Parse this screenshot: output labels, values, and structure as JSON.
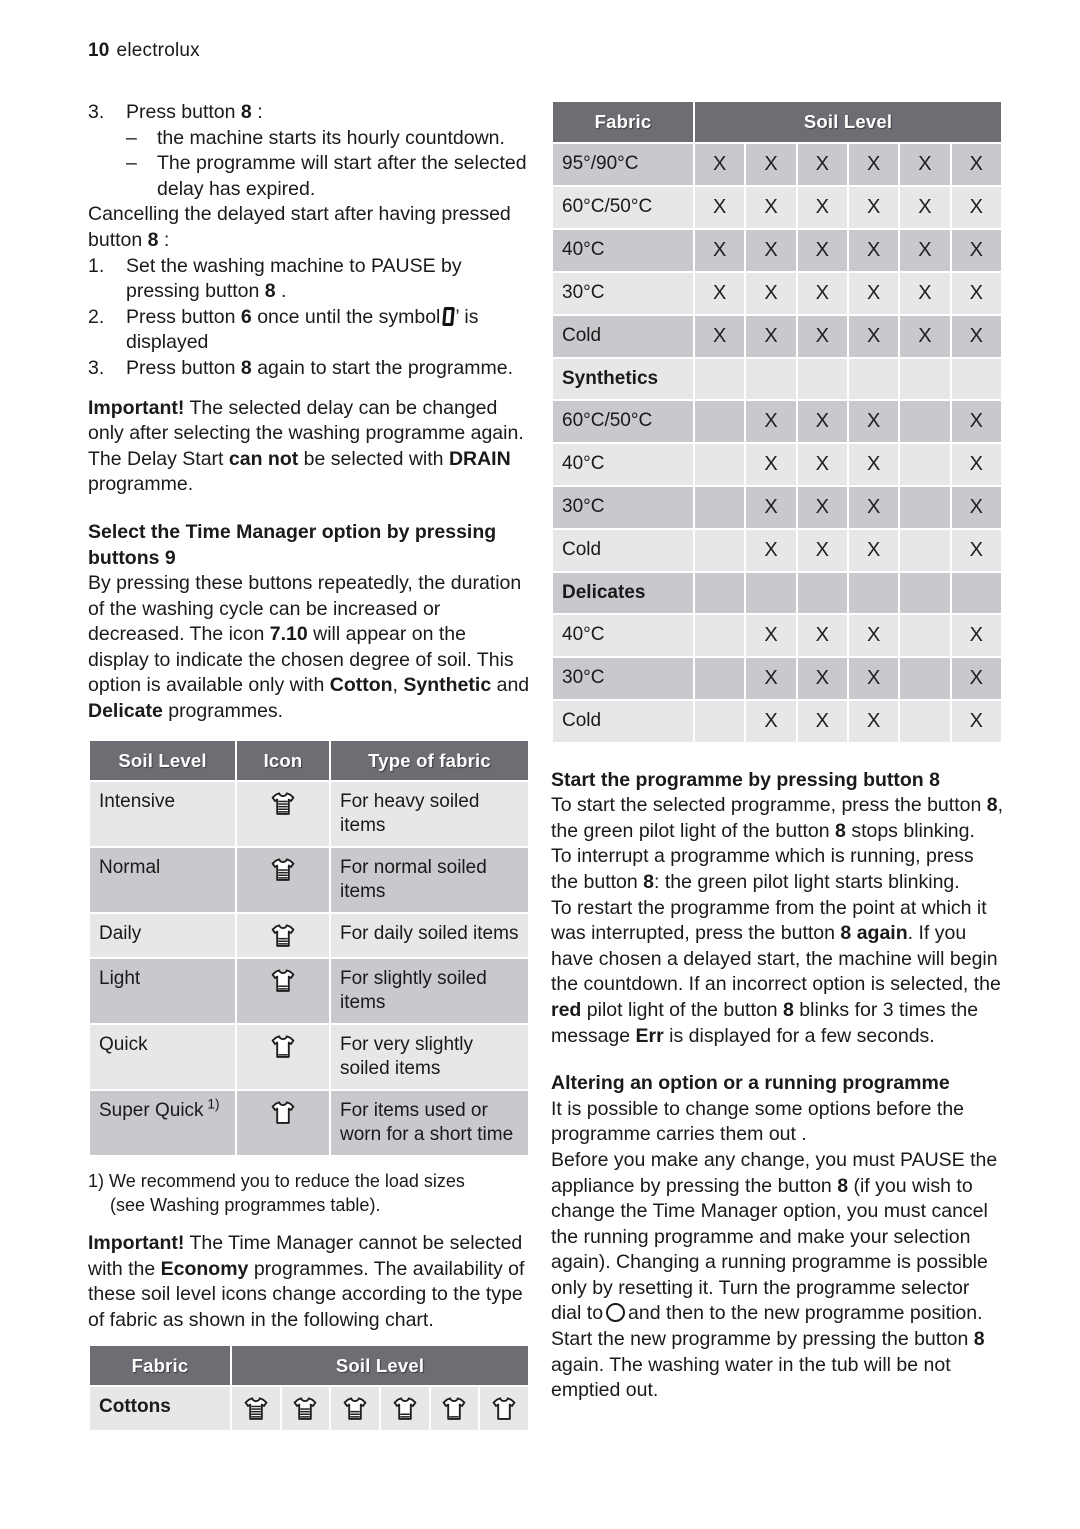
{
  "header": {
    "page_number": "10",
    "brand": "electrolux"
  },
  "left_column": {
    "step3": {
      "marker": "3.",
      "text": "Press button",
      "button": "8",
      "colon": ":",
      "sub1_marker": "–",
      "sub1": "the machine starts its hourly countdown.",
      "sub2_marker": "–",
      "sub2": "The programme will start after the selected delay has expired."
    },
    "cancel_intro_a": "Cancelling the delayed start after having pressed button",
    "cancel_intro_button": "8",
    "cancel_intro_b": ":",
    "cancel_steps": [
      {
        "marker": "1.",
        "pre": "Set the washing machine to PAUSE by pressing button",
        "button": "8",
        "post": "."
      },
      {
        "marker": "2.",
        "pre": "Press button",
        "button": "6",
        "mid": "once until the symbol",
        "post": "’ is displayed"
      },
      {
        "marker": "3.",
        "pre": "Press button",
        "button": "8",
        "post": "again to start the programme."
      }
    ],
    "important1_label": "Important!",
    "important1_text": "The selected delay can be changed only after selecting the washing programme again.",
    "drain_a": "The Delay Start",
    "drain_bold1": "can not",
    "drain_b": "be selected with",
    "drain_bold2": "DRAIN",
    "drain_c": "programme.",
    "time_manager_heading": "Select the Time Manager option by pressing buttons 9",
    "time_manager_p1": "By pressing these buttons repeatedly, the duration of the washing cycle can be increased or decreased. The icon",
    "time_manager_icon_ref": "7.10",
    "time_manager_p2": "will appear on the display to indicate the chosen degree of soil. This option is available only with",
    "fabric_cotton": "Cotton",
    "fabric_sep1": ",",
    "fabric_synthetic": "Synthetic",
    "fabric_and": "and",
    "fabric_delicate": "Delicate",
    "time_manager_p3": "programmes.",
    "soil_table": {
      "headers": [
        "Soil Level",
        "Icon",
        "Type of fabric"
      ],
      "rows": [
        {
          "level": "Intensive",
          "fill": 5,
          "fabric": "For heavy soiled items"
        },
        {
          "level": "Normal",
          "fill": 4,
          "fabric": "For normal soiled items"
        },
        {
          "level": "Daily",
          "fill": 3,
          "fabric": "For daily soiled items"
        },
        {
          "level": "Light",
          "fill": 2,
          "fabric": "For slightly soiled items"
        },
        {
          "level": "Quick",
          "fill": 1,
          "fabric": "For very slightly soiled items"
        },
        {
          "level": "Super Quick",
          "footnote": "1)",
          "fill": 0,
          "fabric": "For items used or worn for a short time"
        }
      ]
    },
    "footnote_marker": "1)",
    "footnote_line1": "We recommend you to reduce the load sizes",
    "footnote_line2": "(see Washing programmes table).",
    "important2_label": "Important!",
    "important2_a": "The Time Manager cannot be selected with the",
    "important2_bold": "Economy",
    "important2_b": "programmes. The availability of these soil level icons change according to the type of fabric as shown in the following chart.",
    "fabric_table": {
      "headers": [
        "Fabric",
        "Soil Level"
      ],
      "rows": [
        {
          "fabric": "Cottons",
          "fills": [
            5,
            4,
            3,
            2,
            1,
            0
          ]
        }
      ]
    }
  },
  "right_column": {
    "soil_matrix": {
      "headers": [
        "Fabric",
        "Soil Level"
      ],
      "columns": 6,
      "rows": [
        {
          "label": "95°/90°C",
          "type": "data",
          "shade": "dark",
          "marks": [
            "X",
            "X",
            "X",
            "X",
            "X",
            "X"
          ]
        },
        {
          "label": "60°C/50°C",
          "type": "data",
          "shade": "lite",
          "marks": [
            "X",
            "X",
            "X",
            "X",
            "X",
            "X"
          ]
        },
        {
          "label": "40°C",
          "type": "data",
          "shade": "dark",
          "marks": [
            "X",
            "X",
            "X",
            "X",
            "X",
            "X"
          ]
        },
        {
          "label": "30°C",
          "type": "data",
          "shade": "lite",
          "marks": [
            "X",
            "X",
            "X",
            "X",
            "X",
            "X"
          ]
        },
        {
          "label": "Cold",
          "type": "data",
          "shade": "dark",
          "marks": [
            "X",
            "X",
            "X",
            "X",
            "X",
            "X"
          ]
        },
        {
          "label": "Synthetics",
          "type": "group",
          "shade": "lite",
          "marks": [
            "",
            "",
            "",
            "",
            "",
            ""
          ]
        },
        {
          "label": "60°C/50°C",
          "type": "data",
          "shade": "dark",
          "marks": [
            "",
            "X",
            "X",
            "X",
            "",
            "X"
          ]
        },
        {
          "label": "40°C",
          "type": "data",
          "shade": "lite",
          "marks": [
            "",
            "X",
            "X",
            "X",
            "",
            "X"
          ]
        },
        {
          "label": "30°C",
          "type": "data",
          "shade": "dark",
          "marks": [
            "",
            "X",
            "X",
            "X",
            "",
            "X"
          ]
        },
        {
          "label": "Cold",
          "type": "data",
          "shade": "lite",
          "marks": [
            "",
            "X",
            "X",
            "X",
            "",
            "X"
          ]
        },
        {
          "label": "Delicates",
          "type": "group",
          "shade": "dark",
          "marks": [
            "",
            "",
            "",
            "",
            "",
            ""
          ]
        },
        {
          "label": "40°C",
          "type": "data",
          "shade": "lite",
          "marks": [
            "",
            "X",
            "X",
            "X",
            "",
            "X"
          ]
        },
        {
          "label": "30°C",
          "type": "data",
          "shade": "dark",
          "marks": [
            "",
            "X",
            "X",
            "X",
            "",
            "X"
          ]
        },
        {
          "label": "Cold",
          "type": "data",
          "shade": "lite",
          "marks": [
            "",
            "X",
            "X",
            "X",
            "",
            "X"
          ]
        }
      ]
    },
    "start_heading": "Start the programme by pressing button 8",
    "start_p1_a": "To start the selected programme, press the button",
    "start_p1_btn1": "8",
    "start_p1_b": ", the green pilot light of the button",
    "start_p1_btn2": "8",
    "start_p1_c": "stops blinking.",
    "start_p2_a": "To interrupt a programme which is running, press the button",
    "start_p2_btn": "8",
    "start_p2_b": ": the green pilot light starts blinking.",
    "start_p3_a": "To restart the programme from the point at which it was interrupted, press the button",
    "start_p3_btn": "8",
    "start_p3_bold": "again",
    "start_p3_b": ". If you have chosen a delayed start, the machine will begin the countdown. If an incorrect option is selected, the",
    "start_p3_red": "red",
    "start_p3_c": "pilot light of the button",
    "start_p3_btn2": "8",
    "start_p3_d": "blinks for 3 times the message",
    "start_p3_err": "Err",
    "start_p3_e": "is displayed for a few seconds.",
    "alter_heading": "Altering an option or a running programme",
    "alter_p1": "It is possible to change some options before the programme carries them out .",
    "alter_p2_a": "Before you make any change, you must PAUSE the appliance by pressing the button",
    "alter_p2_btn": "8",
    "alter_p2_b": "(if you wish to change the Time Manager option, you must cancel the running programme and make your selection again). Changing a running programme is possible only by resetting it. Turn the programme selector dial to",
    "alter_p2_c": "and then to the new programme position. Start the new programme by pressing the button",
    "alter_p2_btn2": "8",
    "alter_p2_d": "again. The washing water in the tub will be not emptied out."
  },
  "colors": {
    "table_header_bg": "#6d6d74",
    "row_light": "#e7e7ea",
    "row_dark": "#c8c8cd",
    "text": "#1a1a1a",
    "page_bg": "#ffffff"
  },
  "icons": {
    "tshirt": "tshirt-soil-level-icon",
    "digital_zero": "digital-zero-symbol",
    "dial_off": "dial-off-circle-icon"
  }
}
